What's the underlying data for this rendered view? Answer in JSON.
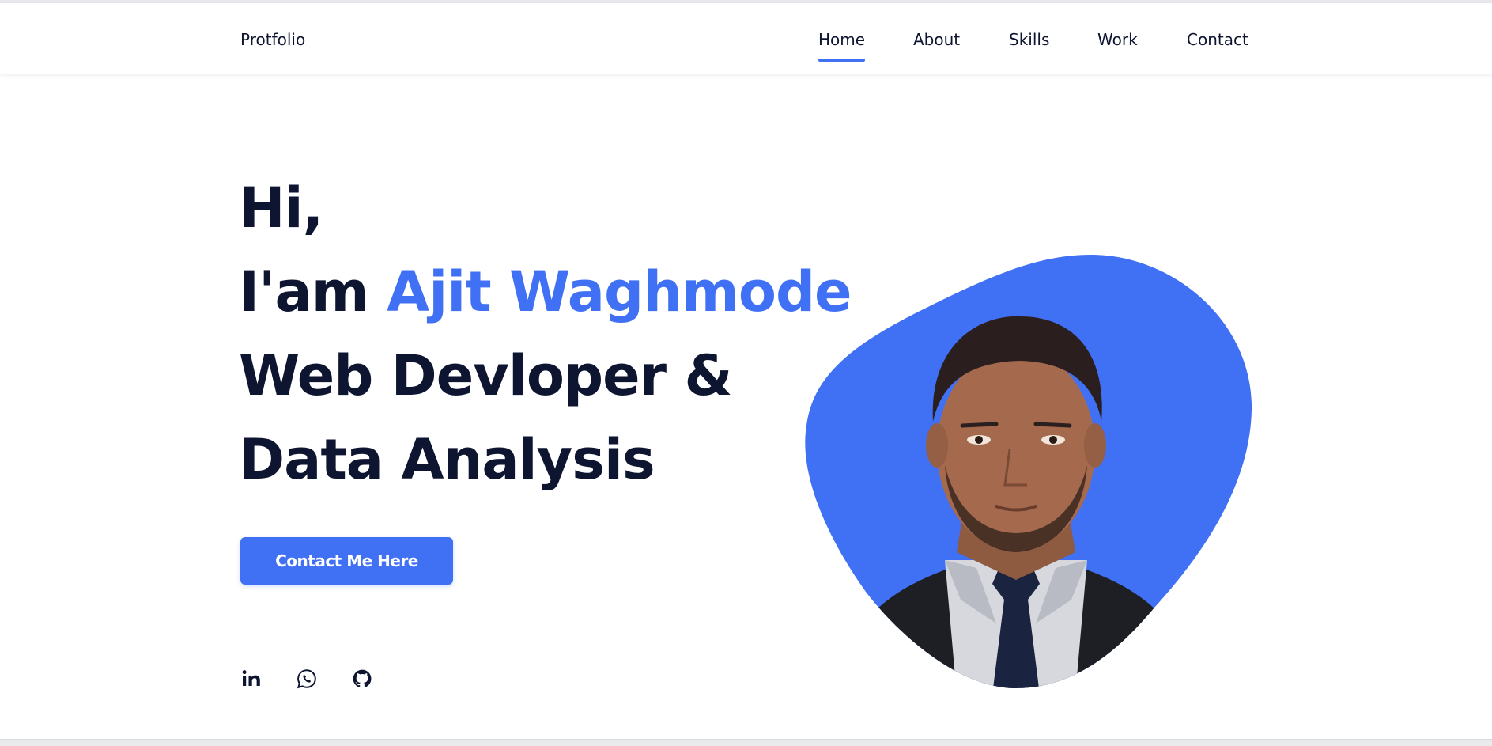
{
  "header": {
    "logo": "Protfolio",
    "nav": [
      "Home",
      "About",
      "Skills",
      "Work",
      "Contact"
    ],
    "active_index": 0
  },
  "hero": {
    "greeting": "Hi,",
    "intro_prefix": "I'am ",
    "name": "Ajit Waghmode",
    "role_line_1": "Web Devloper &",
    "role_line_2": "Data Analysis",
    "cta_label": "Contact Me Here"
  },
  "socials": [
    "linkedin-icon",
    "whatsapp-icon",
    "github-icon"
  ],
  "colors": {
    "accent": "#4070f4",
    "text": "#0e1530",
    "background": "#ffffff"
  }
}
